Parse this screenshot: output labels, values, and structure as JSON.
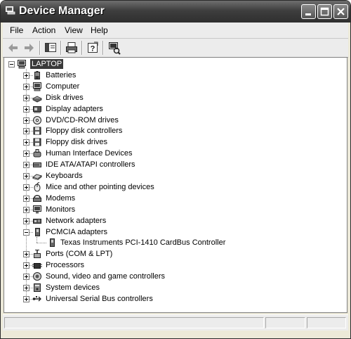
{
  "window": {
    "title": "Device Manager"
  },
  "menu": [
    "File",
    "Action",
    "View",
    "Help"
  ],
  "toolbar": [
    {
      "name": "back-icon"
    },
    {
      "name": "forward-icon"
    },
    {
      "name": "show-hide-console-tree-icon"
    },
    {
      "name": "print-icon"
    },
    {
      "name": "help-icon"
    },
    {
      "name": "scan-hardware-icon"
    }
  ],
  "tree": {
    "root": "LAPTOP",
    "items": [
      {
        "label": "Batteries",
        "icon": "battery-icon",
        "expanded": false
      },
      {
        "label": "Computer",
        "icon": "computer-icon",
        "expanded": false
      },
      {
        "label": "Disk drives",
        "icon": "disk-drive-icon",
        "expanded": false
      },
      {
        "label": "Display adapters",
        "icon": "display-adapter-icon",
        "expanded": false
      },
      {
        "label": "DVD/CD-ROM drives",
        "icon": "cd-drive-icon",
        "expanded": false
      },
      {
        "label": "Floppy disk controllers",
        "icon": "floppy-controller-icon",
        "expanded": false
      },
      {
        "label": "Floppy disk drives",
        "icon": "floppy-drive-icon",
        "expanded": false
      },
      {
        "label": "Human Interface Devices",
        "icon": "hid-icon",
        "expanded": false
      },
      {
        "label": "IDE ATA/ATAPI controllers",
        "icon": "ide-controller-icon",
        "expanded": false
      },
      {
        "label": "Keyboards",
        "icon": "keyboard-icon",
        "expanded": false
      },
      {
        "label": "Mice and other pointing devices",
        "icon": "mouse-icon",
        "expanded": false
      },
      {
        "label": "Modems",
        "icon": "modem-icon",
        "expanded": false
      },
      {
        "label": "Monitors",
        "icon": "monitor-icon",
        "expanded": false
      },
      {
        "label": "Network adapters",
        "icon": "network-adapter-icon",
        "expanded": false
      },
      {
        "label": "PCMCIA adapters",
        "icon": "pcmcia-icon",
        "expanded": true,
        "children": [
          {
            "label": "Texas Instruments PCI-1410 CardBus Controller",
            "icon": "pcmcia-card-icon"
          }
        ]
      },
      {
        "label": "Ports (COM & LPT)",
        "icon": "port-icon",
        "expanded": false
      },
      {
        "label": "Processors",
        "icon": "processor-icon",
        "expanded": false
      },
      {
        "label": "Sound, video and game controllers",
        "icon": "sound-icon",
        "expanded": false
      },
      {
        "label": "System devices",
        "icon": "system-device-icon",
        "expanded": false
      },
      {
        "label": "Universal Serial Bus controllers",
        "icon": "usb-icon",
        "expanded": false
      }
    ]
  }
}
